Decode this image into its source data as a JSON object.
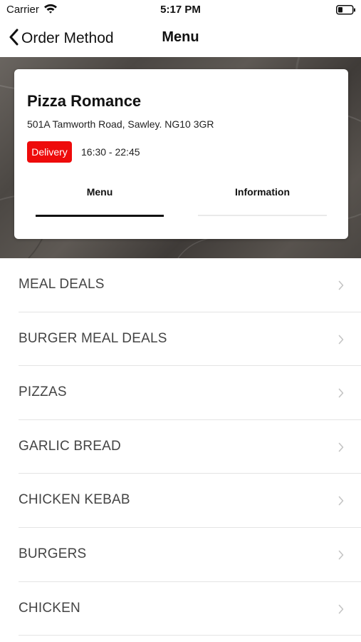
{
  "status_bar": {
    "carrier": "Carrier",
    "time": "5:17 PM",
    "wifi_icon": "wifi-icon",
    "battery_icon": "battery-low-icon"
  },
  "nav": {
    "back_label": "Order Method",
    "back_icon": "chevron-left-icon",
    "title": "Menu"
  },
  "store": {
    "name": "Pizza Romance",
    "address": "501A Tamworth Road, Sawley. NG10 3GR",
    "badge": "Delivery",
    "badge_color": "#ee0b0b",
    "hours": "16:30 - 22:45"
  },
  "tabs": [
    {
      "label": "Menu",
      "active": true
    },
    {
      "label": "Information",
      "active": false
    }
  ],
  "menu": {
    "chevron_icon": "chevron-right-icon",
    "items": [
      {
        "label": "MEAL DEALS"
      },
      {
        "label": "BURGER MEAL DEALS"
      },
      {
        "label": "PIZZAS"
      },
      {
        "label": "GARLIC BREAD"
      },
      {
        "label": "CHICKEN KEBAB"
      },
      {
        "label": "BURGERS"
      },
      {
        "label": "CHICKEN"
      }
    ]
  }
}
